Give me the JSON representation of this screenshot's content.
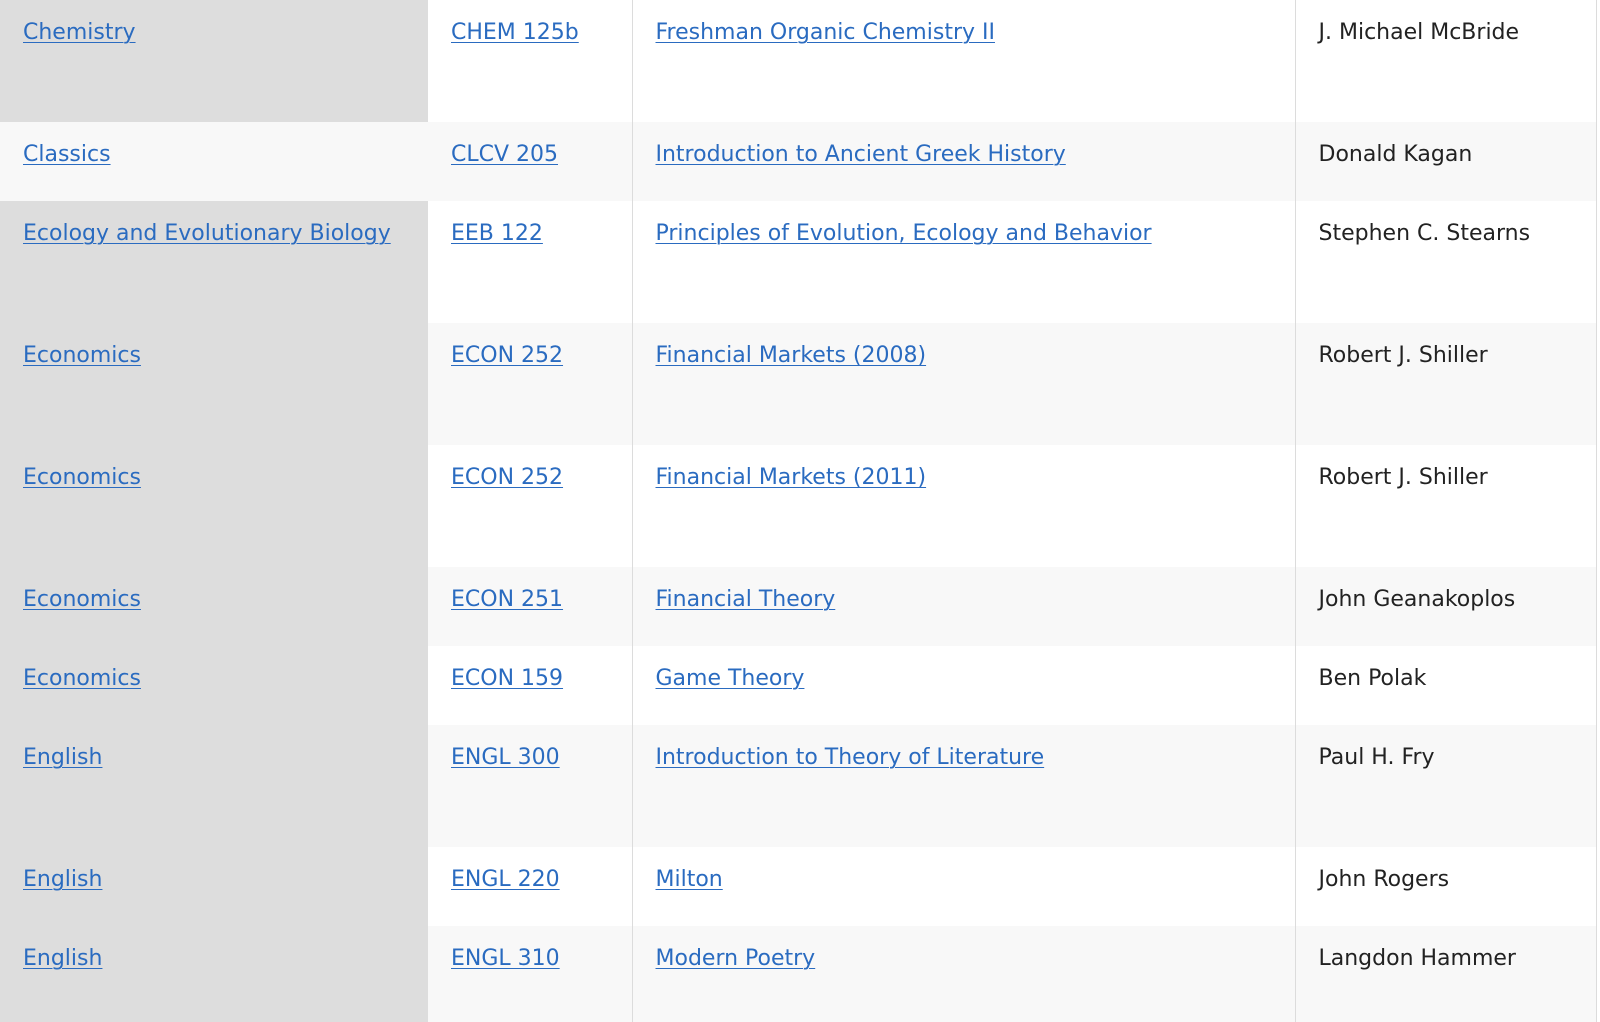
{
  "courses": [
    {
      "department": "Chemistry",
      "number": "CHEM 125b",
      "title": "Freshman Organic Chemistry II",
      "professor": "J. Michael McBride"
    },
    {
      "department": "Classics",
      "number": "CLCV 205",
      "title": "Introduction to Ancient Greek History",
      "professor": "Donald Kagan"
    },
    {
      "department": "Ecology and Evolutionary Biology",
      "number": "EEB 122",
      "title": "Principles of Evolution, Ecology and Behavior",
      "professor": "Stephen C. Stearns"
    },
    {
      "department": "Economics",
      "number": "ECON 252",
      "title": "Financial Markets (2008)",
      "professor": "Robert J. Shiller"
    },
    {
      "department": "Economics",
      "number": "ECON 252",
      "title": "Financial Markets (2011)",
      "professor": "Robert J. Shiller"
    },
    {
      "department": "Economics",
      "number": "ECON 251",
      "title": "Financial Theory",
      "professor": "John Geanakoplos"
    },
    {
      "department": "Economics",
      "number": "ECON 159",
      "title": "Game Theory",
      "professor": "Ben Polak"
    },
    {
      "department": "English",
      "number": "ENGL 300",
      "title": "Introduction to Theory of Literature",
      "professor": "Paul H. Fry"
    },
    {
      "department": "English",
      "number": "ENGL 220",
      "title": "Milton",
      "professor": "John Rogers"
    },
    {
      "department": "English",
      "number": "ENGL 310",
      "title": "Modern Poetry",
      "professor": "Langdon Hammer"
    }
  ]
}
